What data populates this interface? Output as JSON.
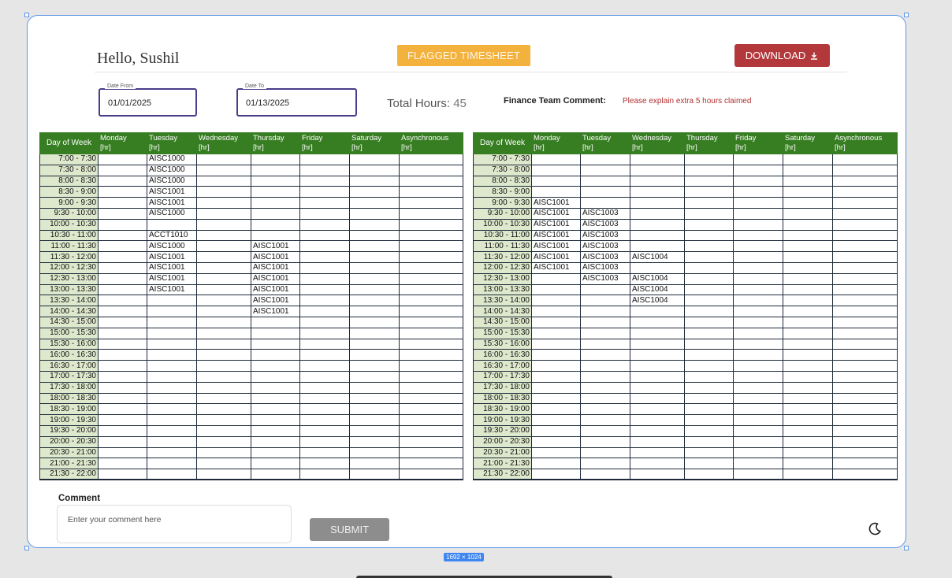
{
  "header": {
    "greeting": "Hello, Sushil",
    "flagged_label": "FLAGGED TIMESHEET",
    "download_label": "DOWNLOAD"
  },
  "filters": {
    "date_from_label": "Date From",
    "date_from_value": "01/01/2025",
    "date_to_label": "Date To",
    "date_to_value": "01/13/2025"
  },
  "summary": {
    "total_hours_label": "Total Hours:",
    "total_hours_value": "45",
    "finance_label": "Finance Team Comment:",
    "finance_comment": "Please explain extra 5 hours claimed"
  },
  "timesheet": {
    "dow_label": "Day of Week",
    "columns": [
      {
        "day": "Monday",
        "unit": "[hr]"
      },
      {
        "day": "Tuesday",
        "unit": "[hr]"
      },
      {
        "day": "Wednesday",
        "unit": "[hr]"
      },
      {
        "day": "Thursday",
        "unit": "[hr]"
      },
      {
        "day": "Friday",
        "unit": "[hr]"
      },
      {
        "day": "Saturday",
        "unit": "[hr]"
      },
      {
        "day": "Asynchronous",
        "unit": "[hr]"
      }
    ],
    "times": [
      "7:00 - 7:30",
      "7:30 - 8:00",
      "8:00 - 8:30",
      "8:30 - 9:00",
      "9:00 - 9:30",
      "9:30 - 10:00",
      "10:00 - 10:30",
      "10:30 - 11:00",
      "11:00 - 11:30",
      "11:30 - 12:00",
      "12:00 - 12:30",
      "12:30 - 13:00",
      "13:00 - 13:30",
      "13:30 - 14:00",
      "14:00 - 14:30",
      "14:30 - 15:00",
      "15:00 - 15:30",
      "15:30 - 16:00",
      "16:00 - 16:30",
      "16:30 - 17:00",
      "17:00 - 17:30",
      "17:30 - 18:00",
      "18:00 - 18:30",
      "18:30 - 19:00",
      "19:00 - 19:30",
      "19:30 - 20:00",
      "20:00 - 20:30",
      "20:30 - 21:00",
      "21:00 - 21:30",
      "21:30 - 22:00"
    ],
    "week1": [
      [
        "",
        "AISC1000",
        "",
        "",
        "",
        "",
        ""
      ],
      [
        "",
        "AISC1000",
        "",
        "",
        "",
        "",
        ""
      ],
      [
        "",
        "AISC1000",
        "",
        "",
        "",
        "",
        ""
      ],
      [
        "",
        "AISC1001",
        "",
        "",
        "",
        "",
        ""
      ],
      [
        "",
        "AISC1001",
        "",
        "",
        "",
        "",
        ""
      ],
      [
        "",
        "AISC1000",
        "",
        "",
        "",
        "",
        ""
      ],
      [
        "",
        "",
        "",
        "",
        "",
        "",
        ""
      ],
      [
        "",
        "ACCT1010",
        "",
        "",
        "",
        "",
        ""
      ],
      [
        "",
        "AISC1000",
        "",
        "AISC1001",
        "",
        "",
        ""
      ],
      [
        "",
        "AISC1001",
        "",
        "AISC1001",
        "",
        "",
        ""
      ],
      [
        "",
        "AISC1001",
        "",
        "AISC1001",
        "",
        "",
        ""
      ],
      [
        "",
        "AISC1001",
        "",
        "AISC1001",
        "",
        "",
        ""
      ],
      [
        "",
        "AISC1001",
        "",
        "AISC1001",
        "",
        "",
        ""
      ],
      [
        "",
        "",
        "",
        "AISC1001",
        "",
        "",
        ""
      ],
      [
        "",
        "",
        "",
        "AISC1001",
        "",
        "",
        ""
      ],
      [
        "",
        "",
        "",
        "",
        "",
        "",
        ""
      ],
      [
        "",
        "",
        "",
        "",
        "",
        "",
        ""
      ],
      [
        "",
        "",
        "",
        "",
        "",
        "",
        ""
      ],
      [
        "",
        "",
        "",
        "",
        "",
        "",
        ""
      ],
      [
        "",
        "",
        "",
        "",
        "",
        "",
        ""
      ],
      [
        "",
        "",
        "",
        "",
        "",
        "",
        ""
      ],
      [
        "",
        "",
        "",
        "",
        "",
        "",
        ""
      ],
      [
        "",
        "",
        "",
        "",
        "",
        "",
        ""
      ],
      [
        "",
        "",
        "",
        "",
        "",
        "",
        ""
      ],
      [
        "",
        "",
        "",
        "",
        "",
        "",
        ""
      ],
      [
        "",
        "",
        "",
        "",
        "",
        "",
        ""
      ],
      [
        "",
        "",
        "",
        "",
        "",
        "",
        ""
      ],
      [
        "",
        "",
        "",
        "",
        "",
        "",
        ""
      ],
      [
        "",
        "",
        "",
        "",
        "",
        "",
        ""
      ],
      [
        "",
        "",
        "",
        "",
        "",
        "",
        ""
      ]
    ],
    "week2": [
      [
        "",
        "",
        "",
        "",
        "",
        "",
        ""
      ],
      [
        "",
        "",
        "",
        "",
        "",
        "",
        ""
      ],
      [
        "",
        "",
        "",
        "",
        "",
        "",
        ""
      ],
      [
        "",
        "",
        "",
        "",
        "",
        "",
        ""
      ],
      [
        "AISC1001",
        "",
        "",
        "",
        "",
        "",
        ""
      ],
      [
        "AISC1001",
        "AISC1003",
        "",
        "",
        "",
        "",
        ""
      ],
      [
        "AISC1001",
        "AISC1003",
        "",
        "",
        "",
        "",
        ""
      ],
      [
        "AISC1001",
        "AISC1003",
        "",
        "",
        "",
        "",
        ""
      ],
      [
        "AISC1001",
        "AISC1003",
        "",
        "",
        "",
        "",
        ""
      ],
      [
        "AISC1001",
        "AISC1003",
        "AISC1004",
        "",
        "",
        "",
        ""
      ],
      [
        "AISC1001",
        "AISC1003",
        "",
        "",
        "",
        "",
        ""
      ],
      [
        "",
        "AISC1003",
        "AISC1004",
        "",
        "",
        "",
        ""
      ],
      [
        "",
        "",
        "AISC1004",
        "",
        "",
        "",
        ""
      ],
      [
        "",
        "",
        "AISC1004",
        "",
        "",
        "",
        ""
      ],
      [
        "",
        "",
        "",
        "",
        "",
        "",
        ""
      ],
      [
        "",
        "",
        "",
        "",
        "",
        "",
        ""
      ],
      [
        "",
        "",
        "",
        "",
        "",
        "",
        ""
      ],
      [
        "",
        "",
        "",
        "",
        "",
        "",
        ""
      ],
      [
        "",
        "",
        "",
        "",
        "",
        "",
        ""
      ],
      [
        "",
        "",
        "",
        "",
        "",
        "",
        ""
      ],
      [
        "",
        "",
        "",
        "",
        "",
        "",
        ""
      ],
      [
        "",
        "",
        "",
        "",
        "",
        "",
        ""
      ],
      [
        "",
        "",
        "",
        "",
        "",
        "",
        ""
      ],
      [
        "",
        "",
        "",
        "",
        "",
        "",
        ""
      ],
      [
        "",
        "",
        "",
        "",
        "",
        "",
        ""
      ],
      [
        "",
        "",
        "",
        "",
        "",
        "",
        ""
      ],
      [
        "",
        "",
        "",
        "",
        "",
        "",
        ""
      ],
      [
        "",
        "",
        "",
        "",
        "",
        "",
        ""
      ],
      [
        "",
        "",
        "",
        "",
        "",
        "",
        ""
      ],
      [
        "",
        "",
        "",
        "",
        "",
        "",
        ""
      ]
    ]
  },
  "comment": {
    "label": "Comment",
    "placeholder": "Enter your comment here",
    "submit_label": "SUBMIT"
  },
  "canvas": {
    "size_badge": "1692 × 1024"
  },
  "icons": {
    "download": "download-icon",
    "theme": "moon-icon"
  }
}
